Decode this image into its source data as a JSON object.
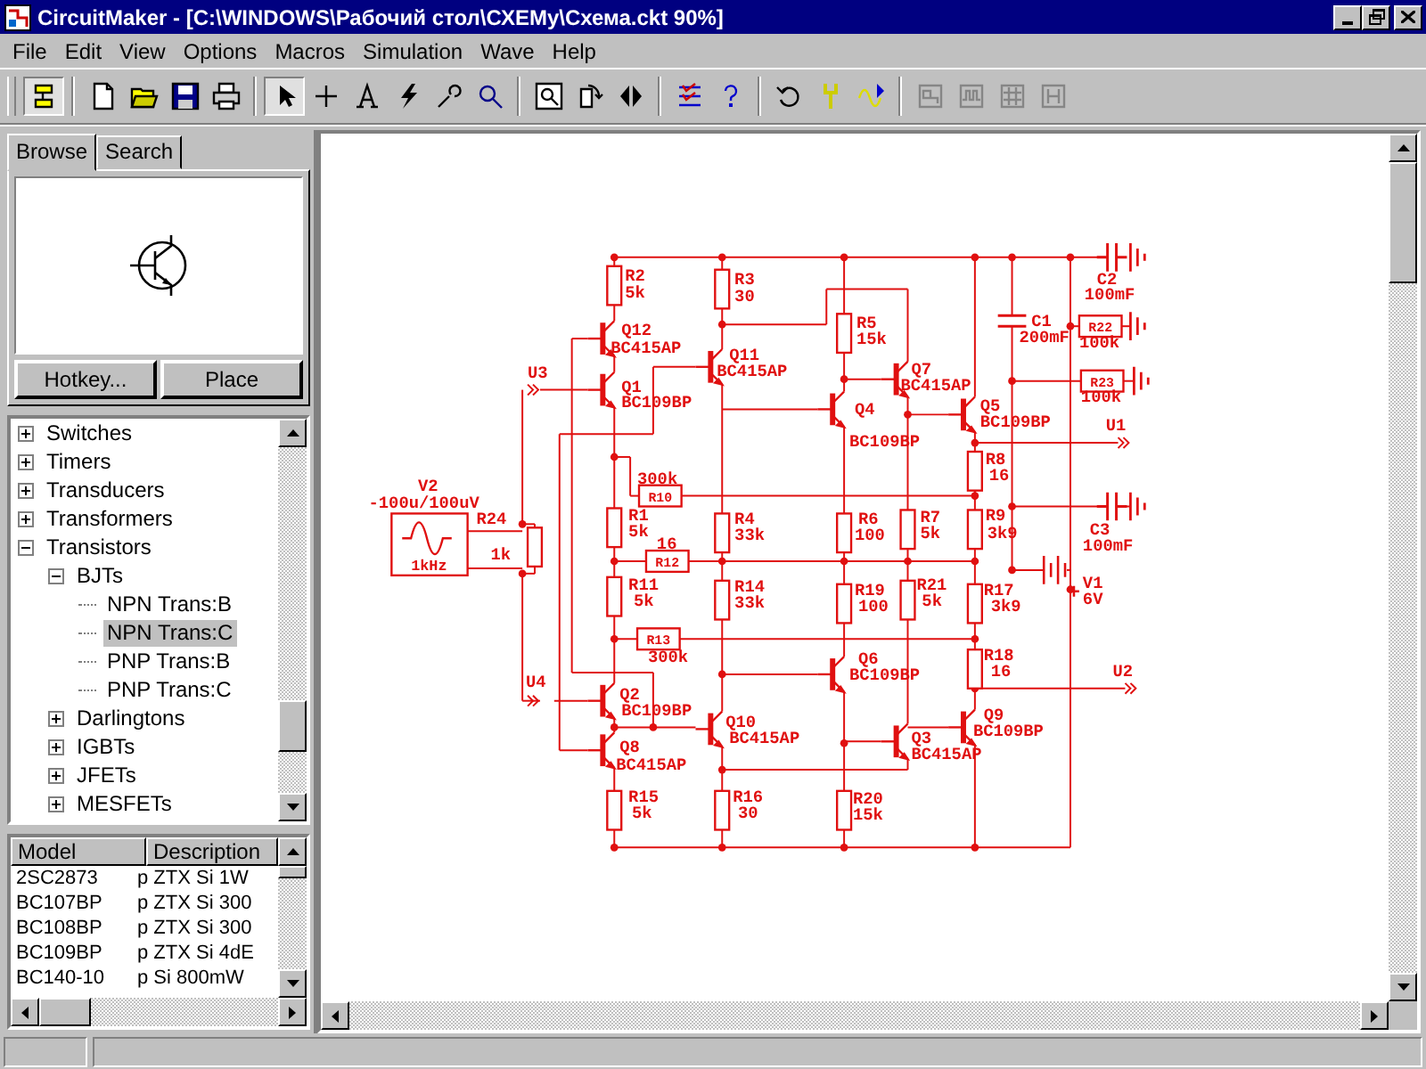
{
  "window": {
    "title": "CircuitMaker - [C:\\WINDOWS\\Рабочий стол\\СХЕМу\\Схема.ckt 90%]"
  },
  "menu": [
    "File",
    "Edit",
    "View",
    "Options",
    "Macros",
    "Simulation",
    "Wave",
    "Help"
  ],
  "toolbar": [
    {
      "pressed": true,
      "disabled": false
    },
    {
      "pressed": false,
      "disabled": false
    },
    {
      "pressed": false,
      "disabled": false
    },
    {
      "pressed": false,
      "disabled": false
    },
    {
      "pressed": false,
      "disabled": false
    },
    {
      "pressed": true,
      "disabled": false
    },
    {
      "pressed": false,
      "disabled": false
    },
    {
      "pressed": false,
      "disabled": false
    },
    {
      "pressed": false,
      "disabled": false
    },
    {
      "pressed": false,
      "disabled": false
    },
    {
      "pressed": false,
      "disabled": false
    },
    {
      "pressed": false,
      "disabled": false
    },
    {
      "pressed": false,
      "disabled": false
    },
    {
      "pressed": false,
      "disabled": false
    },
    {
      "pressed": false,
      "disabled": false
    },
    {
      "pressed": false,
      "disabled": false
    },
    {
      "pressed": false,
      "disabled": false
    },
    {
      "pressed": false,
      "disabled": false
    },
    {
      "pressed": false,
      "disabled": false
    },
    {
      "pressed": false,
      "disabled": true
    },
    {
      "pressed": false,
      "disabled": true
    },
    {
      "pressed": false,
      "disabled": true
    },
    {
      "pressed": false,
      "disabled": true
    }
  ],
  "browser": {
    "tabs": [
      {
        "label": "Browse",
        "selected": true
      },
      {
        "label": "Search",
        "selected": false
      }
    ],
    "buttons": [
      "Hotkey...",
      "Place"
    ],
    "tree": [
      {
        "label": "Switches",
        "expanded": false,
        "selected": false
      },
      {
        "label": "Timers",
        "expanded": false,
        "selected": false
      },
      {
        "label": "Transducers",
        "expanded": false,
        "selected": false
      },
      {
        "label": "Transformers",
        "expanded": false,
        "selected": false
      },
      {
        "label": "Transistors",
        "expanded": true,
        "selected": false,
        "children": [
          {
            "label": "BJTs",
            "expanded": true,
            "selected": false,
            "children": [
              {
                "label": "NPN Trans:B",
                "selected": false
              },
              {
                "label": "NPN Trans:C",
                "selected": true
              },
              {
                "label": "PNP Trans:B",
                "selected": false
              },
              {
                "label": "PNP Trans:C",
                "selected": false
              }
            ]
          },
          {
            "label": "Darlingtons",
            "expanded": false,
            "selected": false
          },
          {
            "label": "IGBTs",
            "expanded": false,
            "selected": false
          },
          {
            "label": "JFETs",
            "expanded": false,
            "selected": false
          },
          {
            "label": "MESFETs",
            "expanded": false,
            "selected": false
          }
        ]
      }
    ],
    "models": {
      "columns": [
        "Model",
        "Description"
      ],
      "rows": [
        [
          "2SC2873",
          "p ZTX Si 1W"
        ],
        [
          "BC107BP",
          "p ZTX Si 300"
        ],
        [
          "BC108BP",
          "p ZTX Si 300"
        ],
        [
          "BC109BP",
          "p ZTX Si 4dE"
        ],
        [
          "BC140-10",
          "p Si 800mW"
        ]
      ]
    }
  },
  "schematic": {
    "components": [
      {
        "kind": "resistor",
        "designator": "R2",
        "value": "5k"
      },
      {
        "kind": "resistor",
        "designator": "R3",
        "value": "30"
      },
      {
        "kind": "net-label",
        "designator": "U3"
      },
      {
        "kind": "transistor",
        "designator": "Q12",
        "value": "BC415AP"
      },
      {
        "kind": "transistor",
        "designator": "Q11",
        "value": "BC415AP"
      },
      {
        "kind": "transistor",
        "designator": "Q1",
        "value": "BC109BP"
      },
      {
        "kind": "resistor",
        "designator": "R5",
        "value": "15k"
      },
      {
        "kind": "transistor",
        "designator": "Q7",
        "value": "BC415AP"
      },
      {
        "kind": "capacitor",
        "designator": "C1",
        "value": "200mF"
      },
      {
        "kind": "capacitor",
        "designator": "C2",
        "value": "100mF"
      },
      {
        "kind": "resistor",
        "designator": "R22",
        "value": "100k"
      },
      {
        "kind": "resistor",
        "designator": "R23",
        "value": "100k"
      },
      {
        "kind": "transistor",
        "designator": "Q4",
        "value": "BC109BP"
      },
      {
        "kind": "transistor",
        "designator": "Q5",
        "value": "BC109BP"
      },
      {
        "kind": "net-label",
        "designator": "U1"
      },
      {
        "kind": "sine-source",
        "designator": "V2",
        "value": "-100u/100uV",
        "frequency": "1kHz"
      },
      {
        "kind": "resistor",
        "designator": "R24",
        "value": "1k"
      },
      {
        "kind": "resistor",
        "designator": "R10",
        "value": "300k"
      },
      {
        "kind": "resistor",
        "designator": "R8",
        "value": "16"
      },
      {
        "kind": "resistor",
        "designator": "R1",
        "value": "5k"
      },
      {
        "kind": "resistor",
        "designator": "R4",
        "value": "33k"
      },
      {
        "kind": "resistor",
        "designator": "R6",
        "value": "100"
      },
      {
        "kind": "resistor",
        "designator": "R7",
        "value": "5k"
      },
      {
        "kind": "resistor",
        "designator": "R9",
        "value": "3k9"
      },
      {
        "kind": "resistor",
        "designator": "R12",
        "value": "16"
      },
      {
        "kind": "capacitor",
        "designator": "C3",
        "value": "100mF"
      },
      {
        "kind": "resistor",
        "designator": "R11",
        "value": "5k"
      },
      {
        "kind": "resistor",
        "designator": "R14",
        "value": "33k"
      },
      {
        "kind": "resistor",
        "designator": "R19",
        "value": "100"
      },
      {
        "kind": "resistor",
        "designator": "R21",
        "value": "5k"
      },
      {
        "kind": "resistor",
        "designator": "R17",
        "value": "3k9"
      },
      {
        "kind": "battery",
        "designator": "V1",
        "value": "6V"
      },
      {
        "kind": "resistor",
        "designator": "R13",
        "value": "300k"
      },
      {
        "kind": "transistor",
        "designator": "Q6",
        "value": "BC109BP"
      },
      {
        "kind": "resistor",
        "designator": "R18",
        "value": "16"
      },
      {
        "kind": "net-label",
        "designator": "U2"
      },
      {
        "kind": "net-label",
        "designator": "U4"
      },
      {
        "kind": "transistor",
        "designator": "Q2",
        "value": "BC109BP"
      },
      {
        "kind": "transistor",
        "designator": "Q10",
        "value": "BC415AP"
      },
      {
        "kind": "transistor",
        "designator": "Q9",
        "value": "BC109BP"
      },
      {
        "kind": "transistor",
        "designator": "Q3",
        "value": "BC415AP"
      },
      {
        "kind": "transistor",
        "designator": "Q8",
        "value": "BC415AP"
      },
      {
        "kind": "resistor",
        "designator": "R15",
        "value": "5k"
      },
      {
        "kind": "resistor",
        "designator": "R16",
        "value": "30"
      },
      {
        "kind": "resistor",
        "designator": "R20",
        "value": "15k"
      }
    ]
  }
}
